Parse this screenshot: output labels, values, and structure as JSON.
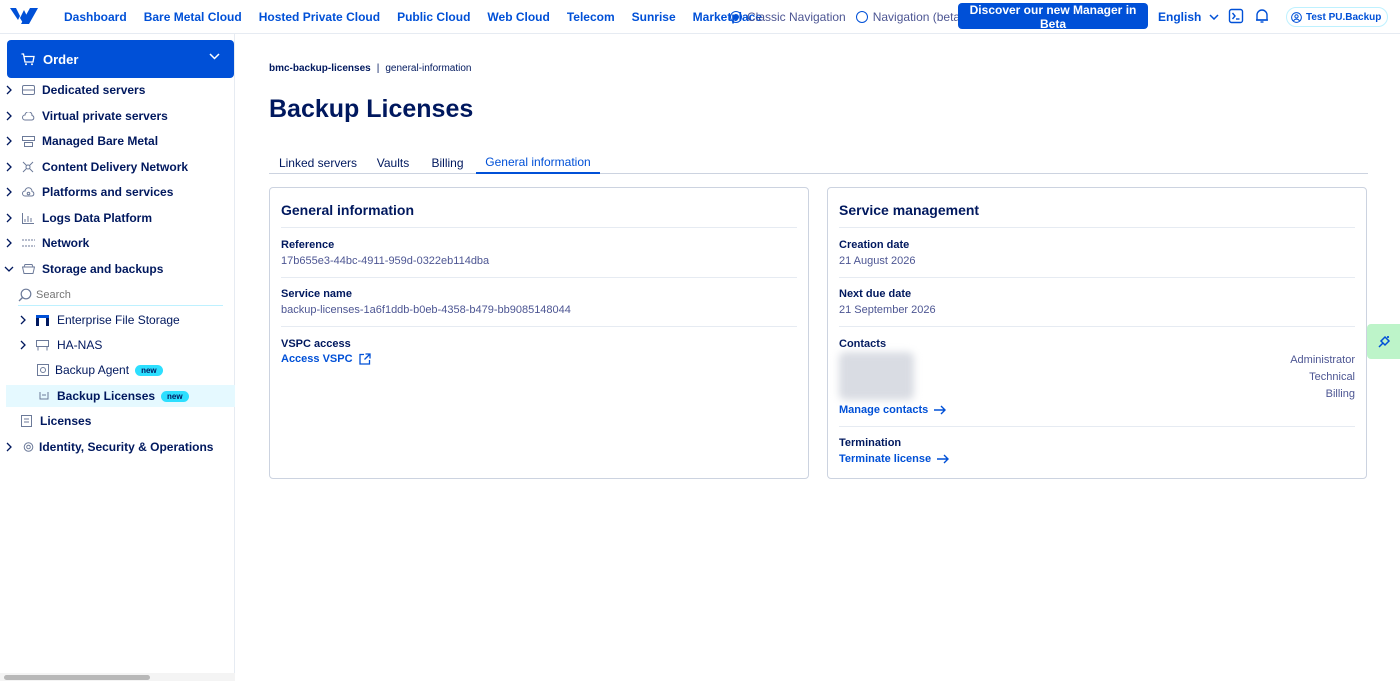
{
  "topbar": {
    "nav": [
      "Dashboard",
      "Bare Metal Cloud",
      "Hosted Private Cloud",
      "Public Cloud",
      "Web Cloud",
      "Telecom",
      "Sunrise",
      "Marketplace"
    ],
    "radio_classic": "Classic Navigation",
    "radio_beta": "Navigation (beta)",
    "beta_button": "Discover our new Manager in Beta",
    "language": "English",
    "user": "Test PU.Backup"
  },
  "sidebar": {
    "order_label": "Order",
    "items": [
      {
        "label": "Dedicated servers",
        "icon": "server-icon"
      },
      {
        "label": "Virtual private servers",
        "icon": "cloud-icon"
      },
      {
        "label": "Managed Bare Metal",
        "icon": "stack-icon"
      },
      {
        "label": "Content Delivery Network",
        "icon": "network-icon"
      },
      {
        "label": "Platforms and services",
        "icon": "cloud-gear-icon"
      },
      {
        "label": "Logs Data Platform",
        "icon": "chart-icon"
      },
      {
        "label": "Network",
        "icon": "lines-icon"
      },
      {
        "label": "Storage and backups",
        "icon": "storage-icon"
      }
    ],
    "search_placeholder": "Search",
    "sub_items": [
      {
        "label": "Enterprise File Storage"
      },
      {
        "label": "HA-NAS"
      },
      {
        "label": "Backup Agent",
        "badge": "new"
      },
      {
        "label": "Backup Licenses",
        "badge": "new"
      }
    ],
    "licenses": "Licenses",
    "identity": "Identity, Security & Operations"
  },
  "main": {
    "breadcrumb": [
      "bmc-backup-licenses",
      "general-information"
    ],
    "title": "Backup Licenses",
    "tabs": [
      "Linked servers",
      "Vaults",
      "Billing",
      "General information"
    ],
    "active_tab": "General information",
    "general": {
      "title": "General information",
      "reference_label": "Reference",
      "reference_value": "17b655e3-44bc-4911-959d-0322eb114dba",
      "service_name_label": "Service name",
      "service_name_value": "backup-licenses-1a6f1ddb-b0eb-4358-b479-bb9085148044",
      "vspc_label": "VSPC access",
      "vspc_link": "Access VSPC"
    },
    "service": {
      "title": "Service management",
      "creation_label": "Creation date",
      "creation_value": "21 August 2026",
      "due_label": "Next due date",
      "due_value": "21 September 2026",
      "contacts_label": "Contacts",
      "roles": [
        "Administrator",
        "Technical",
        "Billing"
      ],
      "manage_contacts": "Manage contacts",
      "termination_label": "Termination",
      "terminate_link": "Terminate license"
    }
  },
  "colors": {
    "primary": "#0050d7",
    "text": "#00185e",
    "badge": "#2cdfff",
    "active_bg": "#e5f9ff"
  }
}
